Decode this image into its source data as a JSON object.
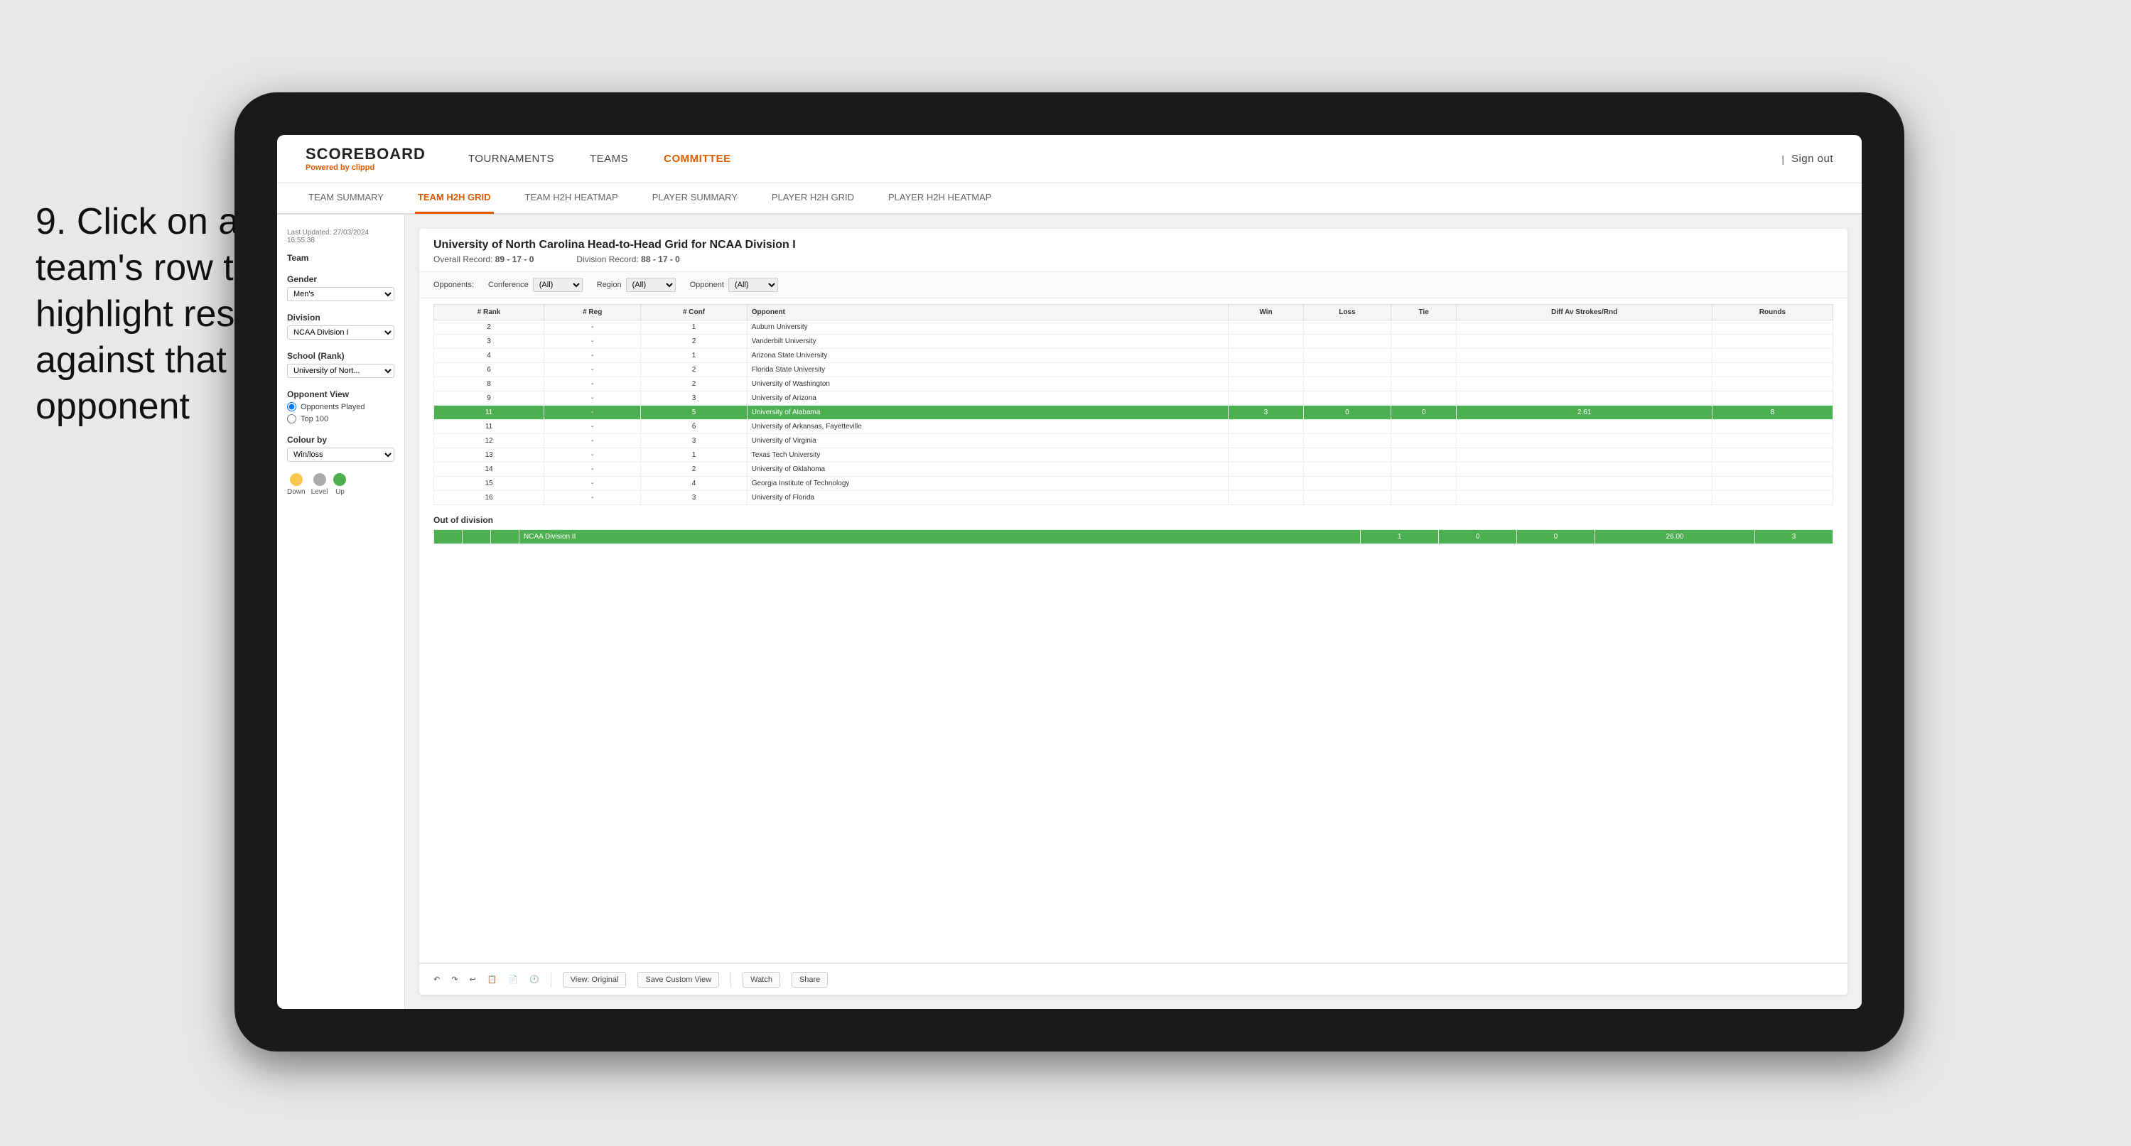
{
  "instruction": {
    "step": "9.",
    "text": "Click on a team's row to highlight results against that opponent"
  },
  "header": {
    "logo": "SCOREBOARD",
    "logo_sub": "Powered by",
    "logo_brand": "clippd",
    "nav": [
      "TOURNAMENTS",
      "TEAMS",
      "COMMITTEE"
    ],
    "sign_out": "Sign out"
  },
  "subnav": {
    "items": [
      "TEAM SUMMARY",
      "TEAM H2H GRID",
      "TEAM H2H HEATMAP",
      "PLAYER SUMMARY",
      "PLAYER H2H GRID",
      "PLAYER H2H HEATMAP"
    ],
    "active": "TEAM H2H GRID"
  },
  "sidebar": {
    "last_updated": "Last Updated: 27/03/2024 16:55:38",
    "team_label": "Team",
    "gender_label": "Gender",
    "gender_value": "Men's",
    "division_label": "Division",
    "division_value": "NCAA Division I",
    "school_label": "School (Rank)",
    "school_value": "University of Nort...",
    "opponent_view_label": "Opponent View",
    "opponent_played": "Opponents Played",
    "top100": "Top 100",
    "colour_by_label": "Colour by",
    "colour_by_value": "Win/loss",
    "legend": {
      "down_label": "Down",
      "down_color": "#f9c74f",
      "level_label": "Level",
      "level_color": "#aaaaaa",
      "up_label": "Up",
      "up_color": "#4caf50"
    }
  },
  "grid": {
    "title": "University of North Carolina Head-to-Head Grid for NCAA Division I",
    "overall_record_label": "Overall Record:",
    "overall_record": "89 - 17 - 0",
    "division_record_label": "Division Record:",
    "division_record": "88 - 17 - 0",
    "filters": {
      "opponents_label": "Opponents:",
      "conference_label": "Conference",
      "conference_value": "(All)",
      "region_label": "Region",
      "region_value": "(All)",
      "opponent_label": "Opponent",
      "opponent_value": "(All)"
    },
    "columns": [
      "# Rank",
      "# Reg",
      "# Conf",
      "Opponent",
      "Win",
      "Loss",
      "Tie",
      "Diff Av Strokes/Rnd",
      "Rounds"
    ],
    "rows": [
      {
        "rank": "2",
        "reg": "-",
        "conf": "1",
        "name": "Auburn University",
        "win": "",
        "loss": "",
        "tie": "",
        "diff": "",
        "rounds": "",
        "highlight": false,
        "win_bg": false
      },
      {
        "rank": "3",
        "reg": "-",
        "conf": "2",
        "name": "Vanderbilt University",
        "win": "",
        "loss": "",
        "tie": "",
        "diff": "",
        "rounds": "",
        "highlight": false
      },
      {
        "rank": "4",
        "reg": "-",
        "conf": "1",
        "name": "Arizona State University",
        "win": "",
        "loss": "",
        "tie": "",
        "diff": "",
        "rounds": "",
        "highlight": false
      },
      {
        "rank": "6",
        "reg": "-",
        "conf": "2",
        "name": "Florida State University",
        "win": "",
        "loss": "",
        "tie": "",
        "diff": "",
        "rounds": "",
        "highlight": false
      },
      {
        "rank": "8",
        "reg": "-",
        "conf": "2",
        "name": "University of Washington",
        "win": "",
        "loss": "",
        "tie": "",
        "diff": "",
        "rounds": "",
        "highlight": false
      },
      {
        "rank": "9",
        "reg": "-",
        "conf": "3",
        "name": "University of Arizona",
        "win": "",
        "loss": "",
        "tie": "",
        "diff": "",
        "rounds": "",
        "highlight": false
      },
      {
        "rank": "11",
        "reg": "-",
        "conf": "5",
        "name": "University of Alabama",
        "win": "3",
        "loss": "0",
        "tie": "0",
        "diff": "2.61",
        "rounds": "8",
        "highlight": true
      },
      {
        "rank": "11",
        "reg": "-",
        "conf": "6",
        "name": "University of Arkansas, Fayetteville",
        "win": "",
        "loss": "",
        "tie": "",
        "diff": "",
        "rounds": "",
        "highlight": false
      },
      {
        "rank": "12",
        "reg": "-",
        "conf": "3",
        "name": "University of Virginia",
        "win": "",
        "loss": "",
        "tie": "",
        "diff": "",
        "rounds": "",
        "highlight": false
      },
      {
        "rank": "13",
        "reg": "-",
        "conf": "1",
        "name": "Texas Tech University",
        "win": "",
        "loss": "",
        "tie": "",
        "diff": "",
        "rounds": "",
        "highlight": false
      },
      {
        "rank": "14",
        "reg": "-",
        "conf": "2",
        "name": "University of Oklahoma",
        "win": "",
        "loss": "",
        "tie": "",
        "diff": "",
        "rounds": "",
        "highlight": false
      },
      {
        "rank": "15",
        "reg": "-",
        "conf": "4",
        "name": "Georgia Institute of Technology",
        "win": "",
        "loss": "",
        "tie": "",
        "diff": "",
        "rounds": "",
        "highlight": false
      },
      {
        "rank": "16",
        "reg": "-",
        "conf": "3",
        "name": "University of Florida",
        "win": "",
        "loss": "",
        "tie": "",
        "diff": "",
        "rounds": "",
        "highlight": false
      }
    ],
    "out_of_division_label": "Out of division",
    "out_of_division_row": {
      "name": "NCAA Division II",
      "win": "1",
      "loss": "0",
      "tie": "0",
      "diff": "26.00",
      "rounds": "3"
    }
  },
  "toolbar": {
    "view_label": "View: Original",
    "save_label": "Save Custom View",
    "watch_label": "Watch",
    "share_label": "Share"
  }
}
